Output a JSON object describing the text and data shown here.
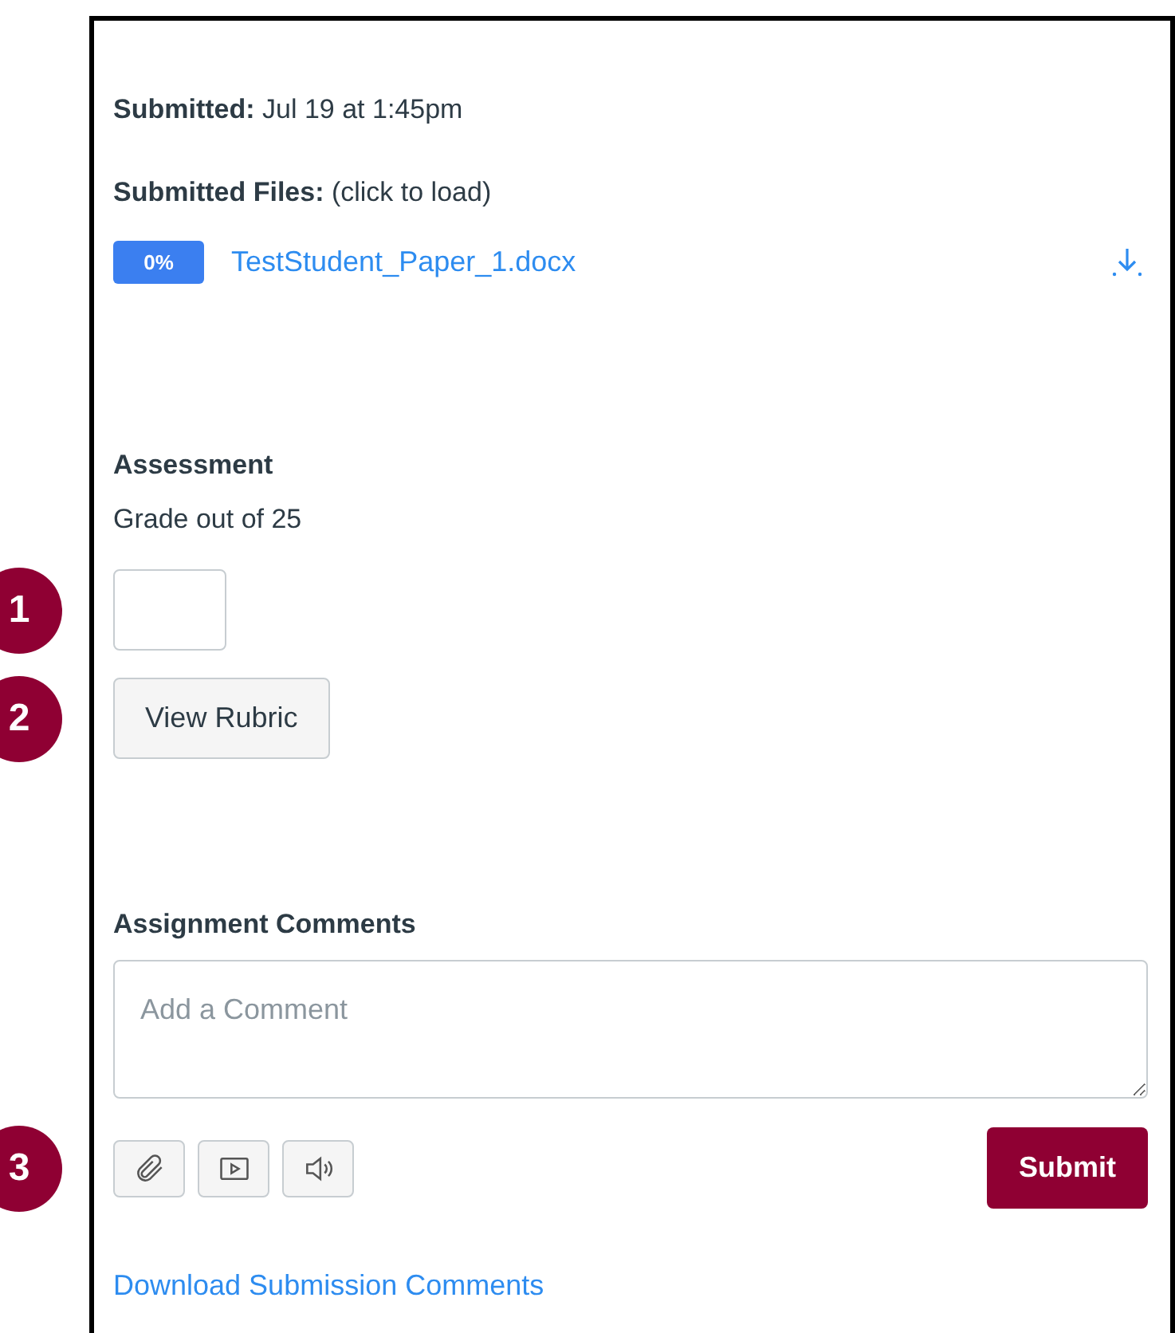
{
  "submission": {
    "submitted_label": "Submitted:",
    "submitted_value": "Jul 19 at 1:45pm",
    "files_label": "Submitted Files:",
    "files_hint": "(click to load)",
    "files": [
      {
        "badge": "0%",
        "name": "TestStudent_Paper_1.docx"
      }
    ]
  },
  "assessment": {
    "heading": "Assessment",
    "grade_label": "Grade out of 25",
    "view_rubric": "View Rubric"
  },
  "comments": {
    "heading": "Assignment Comments",
    "placeholder": "Add a Comment",
    "media_buttons": [
      {
        "kind": "attach"
      },
      {
        "kind": "video"
      },
      {
        "kind": "audio"
      }
    ],
    "submit": "Submit",
    "download_link": "Download Submission Comments"
  },
  "callouts": [
    "1",
    "2",
    "3"
  ]
}
